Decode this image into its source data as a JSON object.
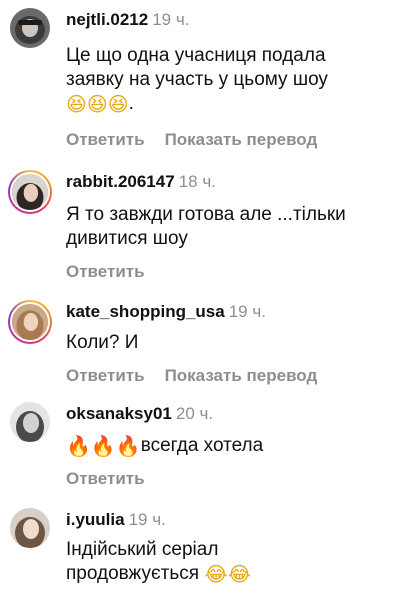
{
  "comments": [
    {
      "username": "nejtli.0212",
      "time": "19 ч.",
      "text_lines": [
        "Це що одна учасниця подала",
        "заявку на участь у цьому шоу"
      ],
      "emoji_line_suffix": ".",
      "emojis": [
        "rofl-emoji",
        "rofl-emoji",
        "rofl-emoji"
      ],
      "reply": "Ответить",
      "translate": "Показать перевод"
    },
    {
      "username": "rabbit.206147",
      "time": "18 ч.",
      "text_lines": [
        "Я то завжди готова але ...тільки",
        "дивитися шоу"
      ],
      "reply": "Ответить"
    },
    {
      "username": "kate_shopping_usa",
      "time": "19 ч.",
      "text_lines": [
        "Коли? И"
      ],
      "reply": "Ответить",
      "translate": "Показать перевод"
    },
    {
      "username": "oksanaksy01",
      "time": "20 ч.",
      "emojis": [
        "fire-emoji",
        "fire-emoji",
        "fire-emoji"
      ],
      "text_after_emojis": "всегда хотела",
      "reply": "Ответить"
    },
    {
      "username": "i.yuulia",
      "time": "19 ч.",
      "text_lines": [
        "Індійський серіал",
        "продовжується"
      ],
      "emojis": [
        "tears-of-joy-emoji",
        "tears-of-joy-emoji"
      ]
    }
  ],
  "colors": {
    "text": "#111111",
    "muted": "#8e8e8e",
    "story_ring_start": "#f7c242",
    "story_ring_end": "#8a3ab9"
  }
}
